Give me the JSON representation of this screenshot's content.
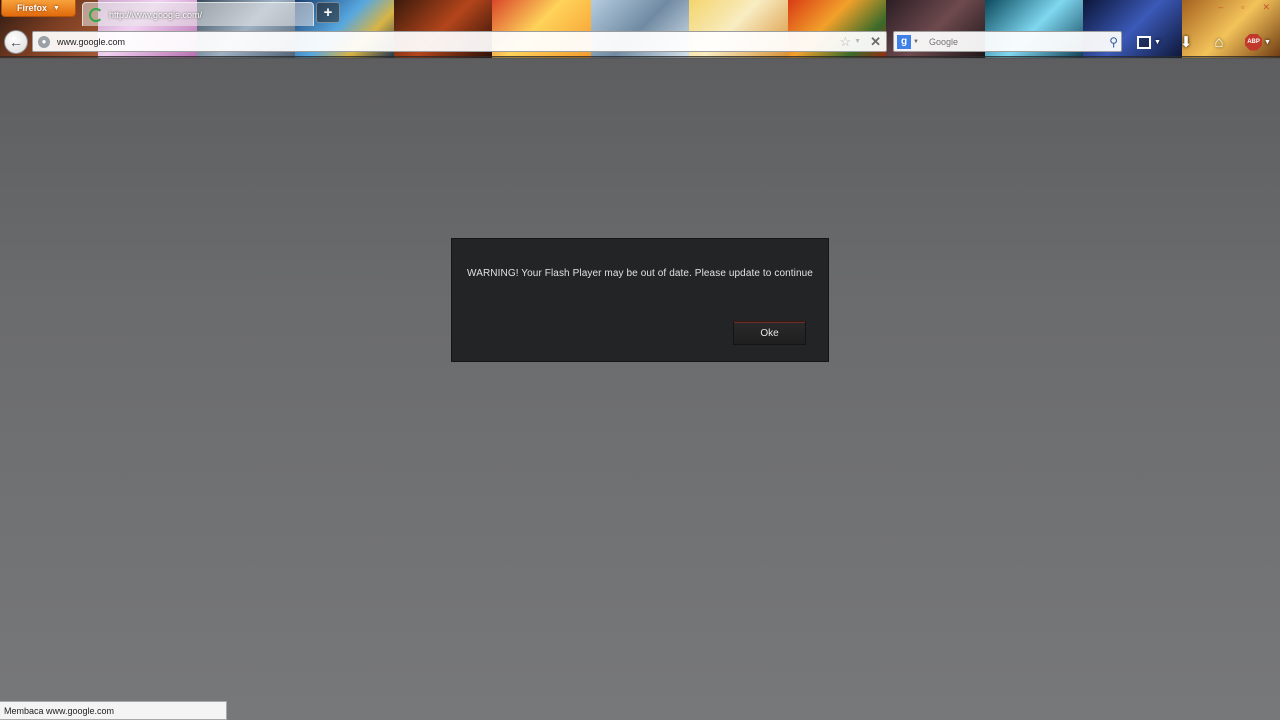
{
  "browser": {
    "menu_button_label": "Firefox",
    "menu_caret": "▼",
    "tab": {
      "title": "http://www.google.com/",
      "loading": true
    },
    "new_tab_label": "+",
    "back_glyph": "←",
    "address_bar": {
      "value": "www.google.com",
      "site_icon": "globe-icon"
    },
    "bookmark_star": "☆",
    "dropdown_caret": "▼",
    "stop_glyph": "✕",
    "search_bar": {
      "engine_letter": "g",
      "placeholder": "Google",
      "search_glyph": "⚲"
    },
    "toolbar_icons": [
      "bookmarks-icon",
      "download-icon",
      "home-icon",
      "adblock-icon"
    ],
    "download_glyph": "⬇",
    "home_glyph": "⌂",
    "adblock_label": "ABP",
    "window_controls": [
      "–",
      "▫",
      "✕"
    ]
  },
  "dialog": {
    "message": "WARNING! Your Flash Player may be out of date. Please update to continue",
    "ok_label": "Oke"
  },
  "status_bar": {
    "text": "Membaca www.google.com"
  },
  "colors": {
    "firefox_orange": "#e16a0c",
    "dialog_bg": "#232425",
    "page_bg_top": "#5a5b5d",
    "page_bg_bottom": "#77787a"
  }
}
